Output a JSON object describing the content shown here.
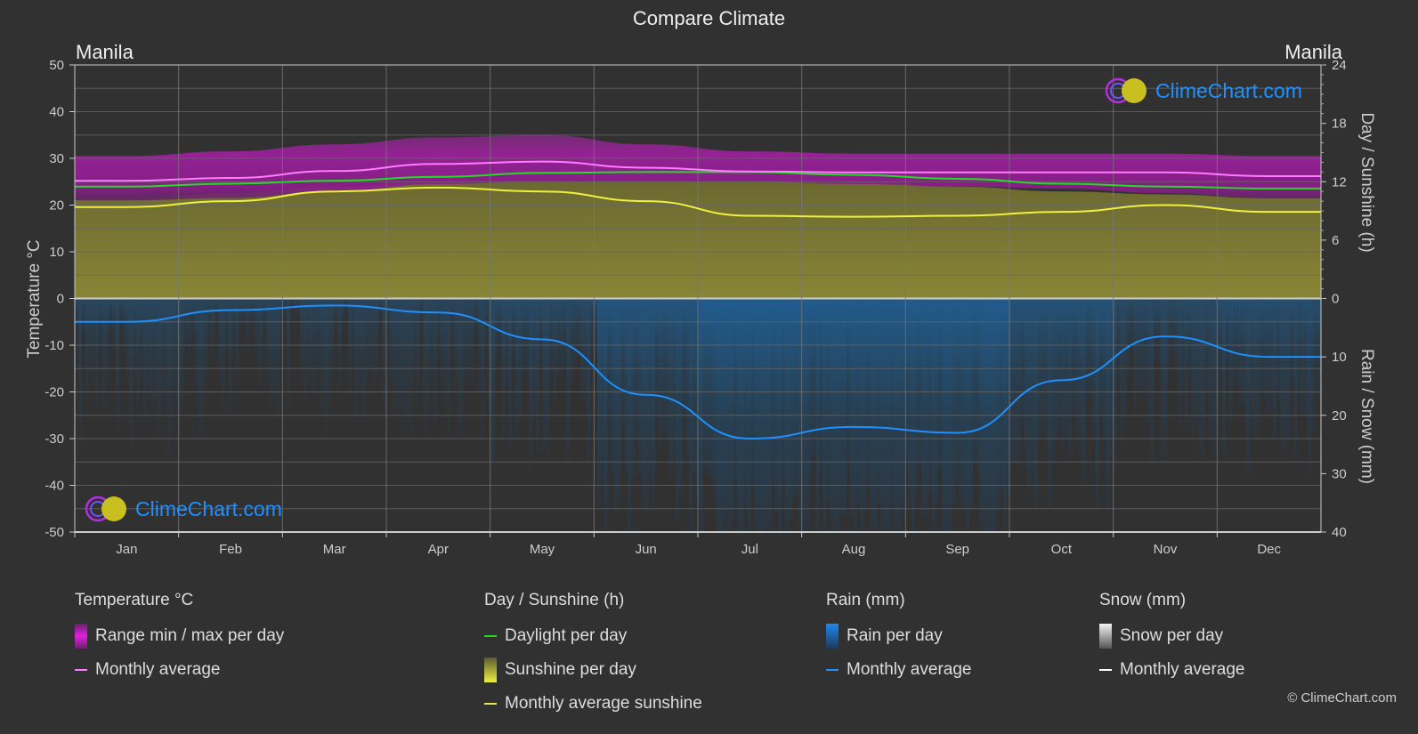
{
  "title": "Compare Climate",
  "location_left": "Manila",
  "location_right": "Manila",
  "watermark": "ClimeChart.com",
  "copyright": "© ClimeChart.com",
  "colors": {
    "background": "#313131",
    "temp_range": "#c21ec2",
    "temp_avg": "#ff7bff",
    "daylight": "#22dd22",
    "sunshine_fill": "#8d8a36",
    "sunshine_avg": "#f0f040",
    "rain_fill": "#1e5a8c",
    "rain_avg": "#1e90ff",
    "snow_avg": "#ffffff",
    "grid": "#5a5a5a"
  },
  "legend": {
    "temperature": {
      "title": "Temperature °C",
      "items": [
        {
          "label": "Range min / max per day",
          "type": "box",
          "color": "#e020e0"
        },
        {
          "label": "Monthly average",
          "type": "line",
          "color": "#ff7bff"
        }
      ]
    },
    "sunshine": {
      "title": "Day / Sunshine (h)",
      "items": [
        {
          "label": "Daylight per day",
          "type": "line",
          "color": "#22dd22"
        },
        {
          "label": "Sunshine per day",
          "type": "box",
          "color": "#e8e840"
        },
        {
          "label": "Monthly average sunshine",
          "type": "line",
          "color": "#e8e840"
        }
      ]
    },
    "rain": {
      "title": "Rain (mm)",
      "items": [
        {
          "label": "Rain per day",
          "type": "box",
          "color": "#1e88e5"
        },
        {
          "label": "Monthly average",
          "type": "line",
          "color": "#1e90ff"
        }
      ]
    },
    "snow": {
      "title": "Snow (mm)",
      "items": [
        {
          "label": "Snow per day",
          "type": "box",
          "color": "#dddddd"
        },
        {
          "label": "Monthly average",
          "type": "line",
          "color": "#ffffff"
        }
      ]
    }
  },
  "chart_data": {
    "type": "line",
    "title": "Compare Climate",
    "categories": [
      "Jan",
      "Feb",
      "Mar",
      "Apr",
      "May",
      "Jun",
      "Jul",
      "Aug",
      "Sep",
      "Oct",
      "Nov",
      "Dec"
    ],
    "y_left": {
      "label": "Temperature °C",
      "range": [
        -50,
        50
      ],
      "ticks": [
        50,
        40,
        30,
        20,
        10,
        0,
        -10,
        -20,
        -30,
        -40,
        -50
      ]
    },
    "y_right_top": {
      "label": "Day / Sunshine (h)",
      "range": [
        0,
        24
      ],
      "ticks": [
        24,
        18,
        12,
        6,
        0
      ]
    },
    "y_right_bottom": {
      "label": "Rain / Snow (mm)",
      "range": [
        0,
        40
      ],
      "ticks": [
        0,
        10,
        20,
        30,
        40
      ]
    },
    "grid": true,
    "series": [
      {
        "name": "Temperature monthly average",
        "axis": "temp",
        "values": [
          25.2,
          25.8,
          27.3,
          28.8,
          29.3,
          28.0,
          27.2,
          27.0,
          27.0,
          27.0,
          27.0,
          26.2
        ]
      },
      {
        "name": "Temperature max (range top)",
        "axis": "temp",
        "values": [
          30.5,
          31.5,
          33,
          34.5,
          35,
          33,
          31.5,
          31,
          31,
          31,
          31,
          30.5
        ]
      },
      {
        "name": "Temperature min (range bottom)",
        "axis": "temp",
        "values": [
          21,
          21.5,
          23,
          24.5,
          25,
          25,
          25,
          24.5,
          24,
          23.5,
          22.5,
          21.5
        ]
      },
      {
        "name": "Daylight per day",
        "axis": "hours",
        "values": [
          11.5,
          11.8,
          12.1,
          12.5,
          12.9,
          13.0,
          13.0,
          12.7,
          12.3,
          11.8,
          11.5,
          11.3
        ]
      },
      {
        "name": "Sunshine per day (max)",
        "axis": "hours",
        "values": [
          10.2,
          10.8,
          11.5,
          12.0,
          12.0,
          12.0,
          12.0,
          12.0,
          11.5,
          11.0,
          10.7,
          10.3
        ]
      },
      {
        "name": "Monthly average sunshine",
        "axis": "hours",
        "values": [
          9.4,
          10.0,
          11.0,
          11.4,
          11.0,
          10.0,
          8.5,
          8.4,
          8.5,
          8.9,
          9.6,
          8.9
        ]
      },
      {
        "name": "Rain monthly average",
        "axis": "mm",
        "values": [
          4.0,
          2.0,
          1.2,
          2.4,
          7.0,
          16.5,
          24.0,
          22.0,
          23.0,
          14.0,
          6.5,
          10.0
        ]
      },
      {
        "name": "Snow monthly average",
        "axis": "mm",
        "values": [
          0,
          0,
          0,
          0,
          0,
          0,
          0,
          0,
          0,
          0,
          0,
          0
        ]
      }
    ]
  }
}
